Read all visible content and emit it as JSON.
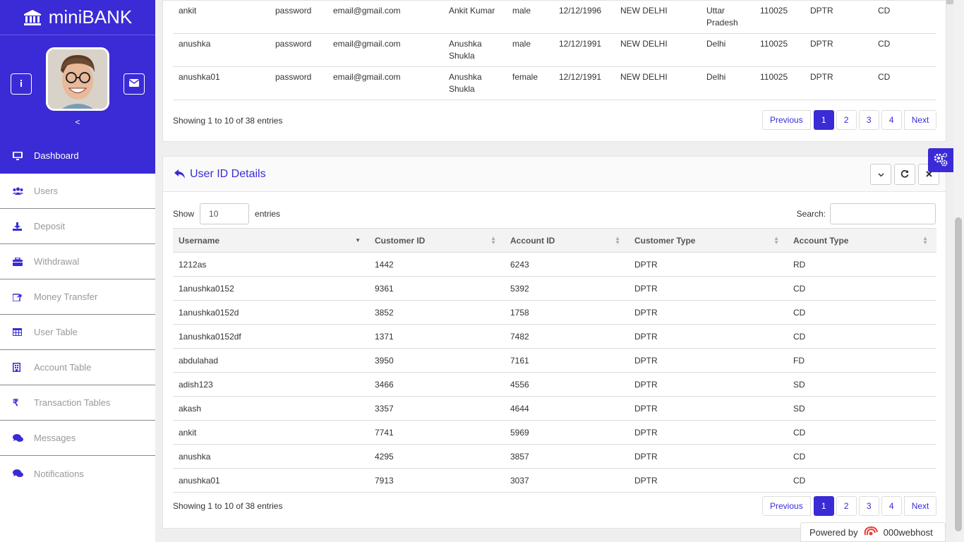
{
  "brand": {
    "name": "miniBANK"
  },
  "profile": {
    "collapse_label": "<"
  },
  "nav": [
    {
      "label": "Dashboard",
      "icon": "desktop-icon",
      "active": true
    },
    {
      "label": "Users",
      "icon": "users-icon"
    },
    {
      "label": "Deposit",
      "icon": "download-icon"
    },
    {
      "label": "Withdrawal",
      "icon": "briefcase-icon"
    },
    {
      "label": "Money Transfer",
      "icon": "share-icon"
    },
    {
      "label": "User Table",
      "icon": "table-icon"
    },
    {
      "label": "Account Table",
      "icon": "building-icon"
    },
    {
      "label": "Transaction Tables",
      "icon": "rupee-icon"
    },
    {
      "label": "Messages",
      "icon": "comments-icon"
    },
    {
      "label": "Notifications",
      "icon": "comments-icon"
    }
  ],
  "top_table": {
    "rows": [
      [
        "ankit",
        "password",
        "email@gmail.com",
        "Ankit Kumar",
        "male",
        "12/12/1996",
        "NEW DELHI",
        "Uttar Pradesh",
        "110025",
        "DPTR",
        "CD"
      ],
      [
        "anushka",
        "password",
        "email@gmail.com",
        "Anushka Shukla",
        "male",
        "12/12/1991",
        "NEW DELHI",
        "Delhi",
        "110025",
        "DPTR",
        "CD"
      ],
      [
        "anushka01",
        "password",
        "email@gmail.com",
        "Anushka Shukla",
        "female",
        "12/12/1991",
        "NEW DELHI",
        "Delhi",
        "110025",
        "DPTR",
        "CD"
      ]
    ],
    "info": "Showing 1 to 10 of 38 entries"
  },
  "pagination": {
    "previous": "Previous",
    "pages": [
      "1",
      "2",
      "3",
      "4"
    ],
    "next": "Next",
    "current": "1"
  },
  "user_id_panel": {
    "title": "User ID Details",
    "show_label": "Show",
    "length_value": "10",
    "entries_label": "entries",
    "search_label": "Search:",
    "search_value": "",
    "columns": [
      "Username",
      "Customer ID",
      "Account ID",
      "Customer Type",
      "Account Type"
    ],
    "rows": [
      [
        "1212as",
        "1442",
        "6243",
        "DPTR",
        "RD"
      ],
      [
        "1anushka0152",
        "9361",
        "5392",
        "DPTR",
        "CD"
      ],
      [
        "1anushka0152d",
        "3852",
        "1758",
        "DPTR",
        "CD"
      ],
      [
        "1anushka0152df",
        "1371",
        "7482",
        "DPTR",
        "CD"
      ],
      [
        "abdulahad",
        "3950",
        "7161",
        "DPTR",
        "FD"
      ],
      [
        "adish123",
        "3466",
        "4556",
        "DPTR",
        "SD"
      ],
      [
        "akash",
        "3357",
        "4644",
        "DPTR",
        "SD"
      ],
      [
        "ankit",
        "7741",
        "5969",
        "DPTR",
        "CD"
      ],
      [
        "anushka",
        "4295",
        "3857",
        "DPTR",
        "CD"
      ],
      [
        "anushka01",
        "7913",
        "3037",
        "DPTR",
        "CD"
      ]
    ],
    "info": "Showing 1 to 10 of 38 entries"
  },
  "powered": {
    "label": "Powered by",
    "brand": "000webhost"
  },
  "colors": {
    "accent": "#3a2bd6"
  }
}
